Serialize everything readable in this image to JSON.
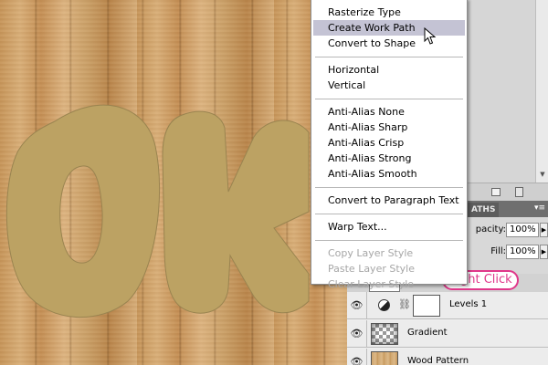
{
  "context_menu": {
    "groups": [
      [
        {
          "label": "Rasterize Type",
          "enabled": true,
          "highlighted": false
        },
        {
          "label": "Create Work Path",
          "enabled": true,
          "highlighted": true
        },
        {
          "label": "Convert to Shape",
          "enabled": true,
          "highlighted": false
        }
      ],
      [
        {
          "label": "Horizontal",
          "enabled": true,
          "highlighted": false
        },
        {
          "label": "Vertical",
          "enabled": true,
          "highlighted": false
        }
      ],
      [
        {
          "label": "Anti-Alias None",
          "enabled": true,
          "highlighted": false
        },
        {
          "label": "Anti-Alias Sharp",
          "enabled": true,
          "highlighted": false
        },
        {
          "label": "Anti-Alias Crisp",
          "enabled": true,
          "highlighted": false
        },
        {
          "label": "Anti-Alias Strong",
          "enabled": true,
          "highlighted": false
        },
        {
          "label": "Anti-Alias Smooth",
          "enabled": true,
          "highlighted": false
        }
      ],
      [
        {
          "label": "Convert to Paragraph Text",
          "enabled": true,
          "highlighted": false
        }
      ],
      [
        {
          "label": "Warp Text...",
          "enabled": true,
          "highlighted": false
        }
      ],
      [
        {
          "label": "Copy Layer Style",
          "enabled": false,
          "highlighted": false
        },
        {
          "label": "Paste Layer Style",
          "enabled": false,
          "highlighted": false
        },
        {
          "label": "Clear Layer Style",
          "enabled": false,
          "highlighted": false
        }
      ]
    ]
  },
  "layers_panel": {
    "tab_label": "ATHS",
    "opacity_label": "pacity:",
    "opacity_value": "100%",
    "fill_label": "Fill:",
    "fill_value": "100%",
    "layers": [
      {
        "name": "Levels 1",
        "type": "adjustment"
      },
      {
        "name": "Gradient",
        "type": "checker"
      },
      {
        "name": "Wood Pattern",
        "type": "wood"
      }
    ]
  },
  "callout": {
    "text": "Right Click"
  },
  "colors": {
    "text_fill": "#bca263",
    "menu_highlight": "#c4c3d4",
    "callout": "#e0378a"
  },
  "icons": {
    "cursor": "arrow-cursor-icon",
    "eye": "eye-icon",
    "chain": "chain-link-icon",
    "adjustment": "adjustment-layer-icon"
  }
}
